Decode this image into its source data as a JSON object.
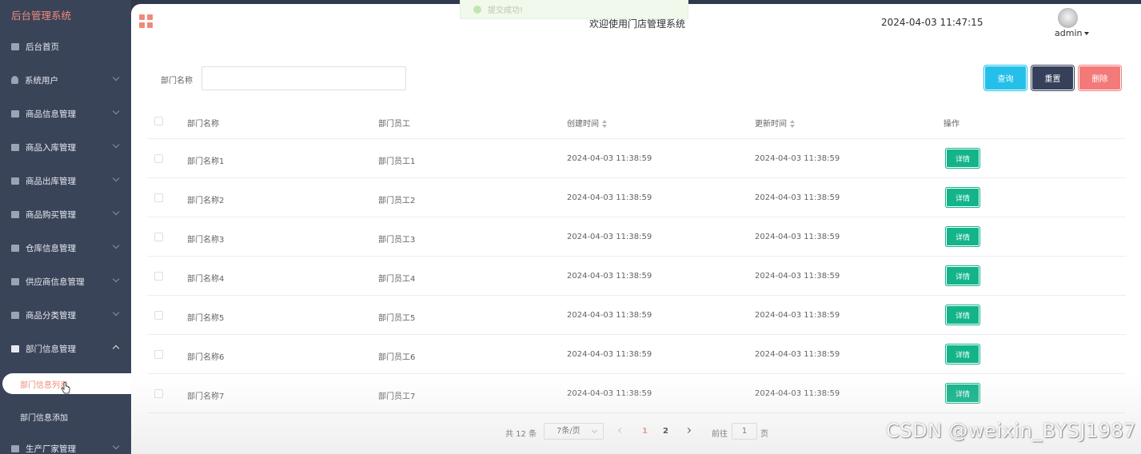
{
  "app": {
    "title": "后台管理系统"
  },
  "sidebar": {
    "items": [
      {
        "label": "后台首页",
        "icon": "monitor-icon",
        "expandable": false
      },
      {
        "label": "系统用户",
        "icon": "user-icon",
        "expandable": true
      },
      {
        "label": "商品信息管理",
        "icon": "chart-icon",
        "expandable": true
      },
      {
        "label": "商品入库管理",
        "icon": "chart-icon",
        "expandable": true
      },
      {
        "label": "商品出库管理",
        "icon": "chart-icon",
        "expandable": true
      },
      {
        "label": "商品购买管理",
        "icon": "chart-icon",
        "expandable": true
      },
      {
        "label": "仓库信息管理",
        "icon": "chart-icon",
        "expandable": true
      },
      {
        "label": "供应商信息管理",
        "icon": "chart-icon",
        "expandable": true
      },
      {
        "label": "商品分类管理",
        "icon": "chart-icon",
        "expandable": true
      },
      {
        "label": "部门信息管理",
        "icon": "chart-icon",
        "expandable": true,
        "expanded": true
      }
    ],
    "submenu": [
      {
        "label": "部门信息列表",
        "active": true
      },
      {
        "label": "部门信息添加",
        "active": false
      }
    ],
    "next_item": {
      "label": "生产厂家管理",
      "icon": "chart-icon"
    }
  },
  "header": {
    "toast": "提交成功!",
    "welcome": "欢迎使用门店管理系统",
    "datetime": "2024-04-03 11:47:15",
    "user": "admin"
  },
  "search": {
    "label": "部门名称",
    "value": "",
    "placeholder": ""
  },
  "buttons": {
    "query": "查询",
    "reset": "重置",
    "delete": "删除"
  },
  "table": {
    "columns": [
      "部门名称",
      "部门员工",
      "创建时间",
      "更新时间",
      "操作"
    ],
    "detail_label": "详情",
    "rows": [
      {
        "name": "部门名称1",
        "staff": "部门员工1",
        "created": "2024-04-03 11:38:59",
        "updated": "2024-04-03 11:38:59"
      },
      {
        "name": "部门名称2",
        "staff": "部门员工2",
        "created": "2024-04-03 11:38:59",
        "updated": "2024-04-03 11:38:59"
      },
      {
        "name": "部门名称3",
        "staff": "部门员工3",
        "created": "2024-04-03 11:38:59",
        "updated": "2024-04-03 11:38:59"
      },
      {
        "name": "部门名称4",
        "staff": "部门员工4",
        "created": "2024-04-03 11:38:59",
        "updated": "2024-04-03 11:38:59"
      },
      {
        "name": "部门名称5",
        "staff": "部门员工5",
        "created": "2024-04-03 11:38:59",
        "updated": "2024-04-03 11:38:59"
      },
      {
        "name": "部门名称6",
        "staff": "部门员工6",
        "created": "2024-04-03 11:38:59",
        "updated": "2024-04-03 11:38:59"
      },
      {
        "name": "部门名称7",
        "staff": "部门员工7",
        "created": "2024-04-03 11:38:59",
        "updated": "2024-04-03 11:38:59"
      }
    ]
  },
  "pagination": {
    "total": "共 12 条",
    "page_size": "7条/页",
    "pages": [
      "1",
      "2"
    ],
    "current": "1",
    "goto": "前往",
    "jump_value": "1",
    "page_suffix": "页"
  },
  "watermark": "CSDN @weixin_BYSJ1987",
  "colors": {
    "sidebar_bg": "#3a4459",
    "accent": "#f08a7a",
    "query": "#24c0ea",
    "reset": "#37405a",
    "delete": "#f47a7a",
    "detail": "#13b48a"
  }
}
